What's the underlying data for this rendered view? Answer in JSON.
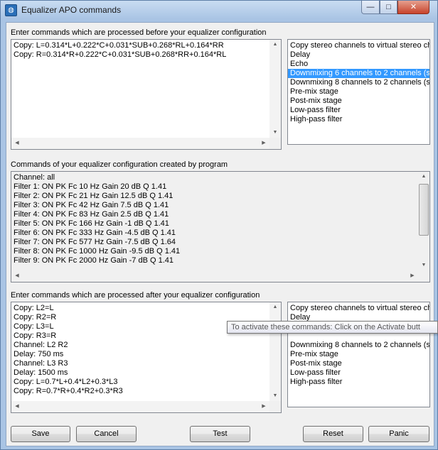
{
  "window": {
    "title": "Equalizer APO commands",
    "icon": "equalizer-apo-app-icon",
    "controls": {
      "minimize": "—",
      "maximize": "□",
      "close": "✕"
    }
  },
  "section_before": {
    "label": "Enter commands which are processed before your equalizer configuration",
    "lines": [
      "Copy: L=0.314*L+0.222*C+0.031*SUB+0.268*RL+0.164*RR",
      "Copy: R=0.314*R+0.222*C+0.031*SUB+0.268*RR+0.164*RL"
    ]
  },
  "list_before": {
    "items": [
      "Copy stereo channels to virtual stereo ch",
      "Delay",
      "Echo",
      "Downmixing 6 channels to 2 channels (st",
      "Downmixing 8 channels to 2 channels (st",
      "Pre-mix stage",
      "Post-mix stage",
      "Low-pass filter",
      "High-pass filter"
    ],
    "selected_index": 3
  },
  "section_program": {
    "label": "Commands of your equalizer configuration created by program",
    "lines": [
      "Channel: all",
      "Filter 1: ON PK Fc 10 Hz Gain 20 dB Q 1.41",
      "Filter 2: ON PK Fc 21 Hz Gain 12.5 dB Q 1.41",
      "Filter 3: ON PK Fc 42 Hz Gain 7.5 dB Q 1.41",
      "Filter 4: ON PK Fc 83 Hz Gain 2.5 dB Q 1.41",
      "Filter 5: ON PK Fc 166 Hz Gain -1 dB Q 1.41",
      "Filter 6: ON PK Fc 333 Hz Gain -4.5 dB Q 1.41",
      "Filter 7: ON PK Fc 577 Hz Gain -7.5 dB Q 1.64",
      "Filter 8: ON PK Fc 1000 Hz Gain -9.5 dB Q 1.41",
      "Filter 9: ON PK Fc 2000 Hz Gain -7 dB Q 1.41"
    ]
  },
  "section_after": {
    "label": "Enter commands which are processed after your equalizer configuration",
    "lines": [
      "Copy: L2=L",
      "Copy: R2=R",
      "Copy: L3=L",
      "Copy: R3=R",
      "Channel: L2 R2",
      "Delay: 750 ms",
      "Channel: L3 R3",
      "Delay: 1500 ms",
      "Copy: L=0.7*L+0.4*L2+0.3*L3",
      "Copy: R=0.7*R+0.4*R2+0.3*R3"
    ]
  },
  "list_after": {
    "items": [
      "Copy stereo channels to virtual stereo ch",
      "Delay",
      "",
      "",
      "Downmixing 8 channels to 2 channels (st",
      "Pre-mix stage",
      "Post-mix stage",
      "Low-pass filter",
      "High-pass filter"
    ]
  },
  "tooltip": {
    "text": "To activate these commands: Click on the Activate butt"
  },
  "buttons": {
    "save": "Save",
    "cancel": "Cancel",
    "test": "Test",
    "reset": "Reset",
    "panic": "Panic"
  },
  "colors": {
    "selection": "#3399ff",
    "frame": "#a9c4e4",
    "close": "#c7432b"
  }
}
